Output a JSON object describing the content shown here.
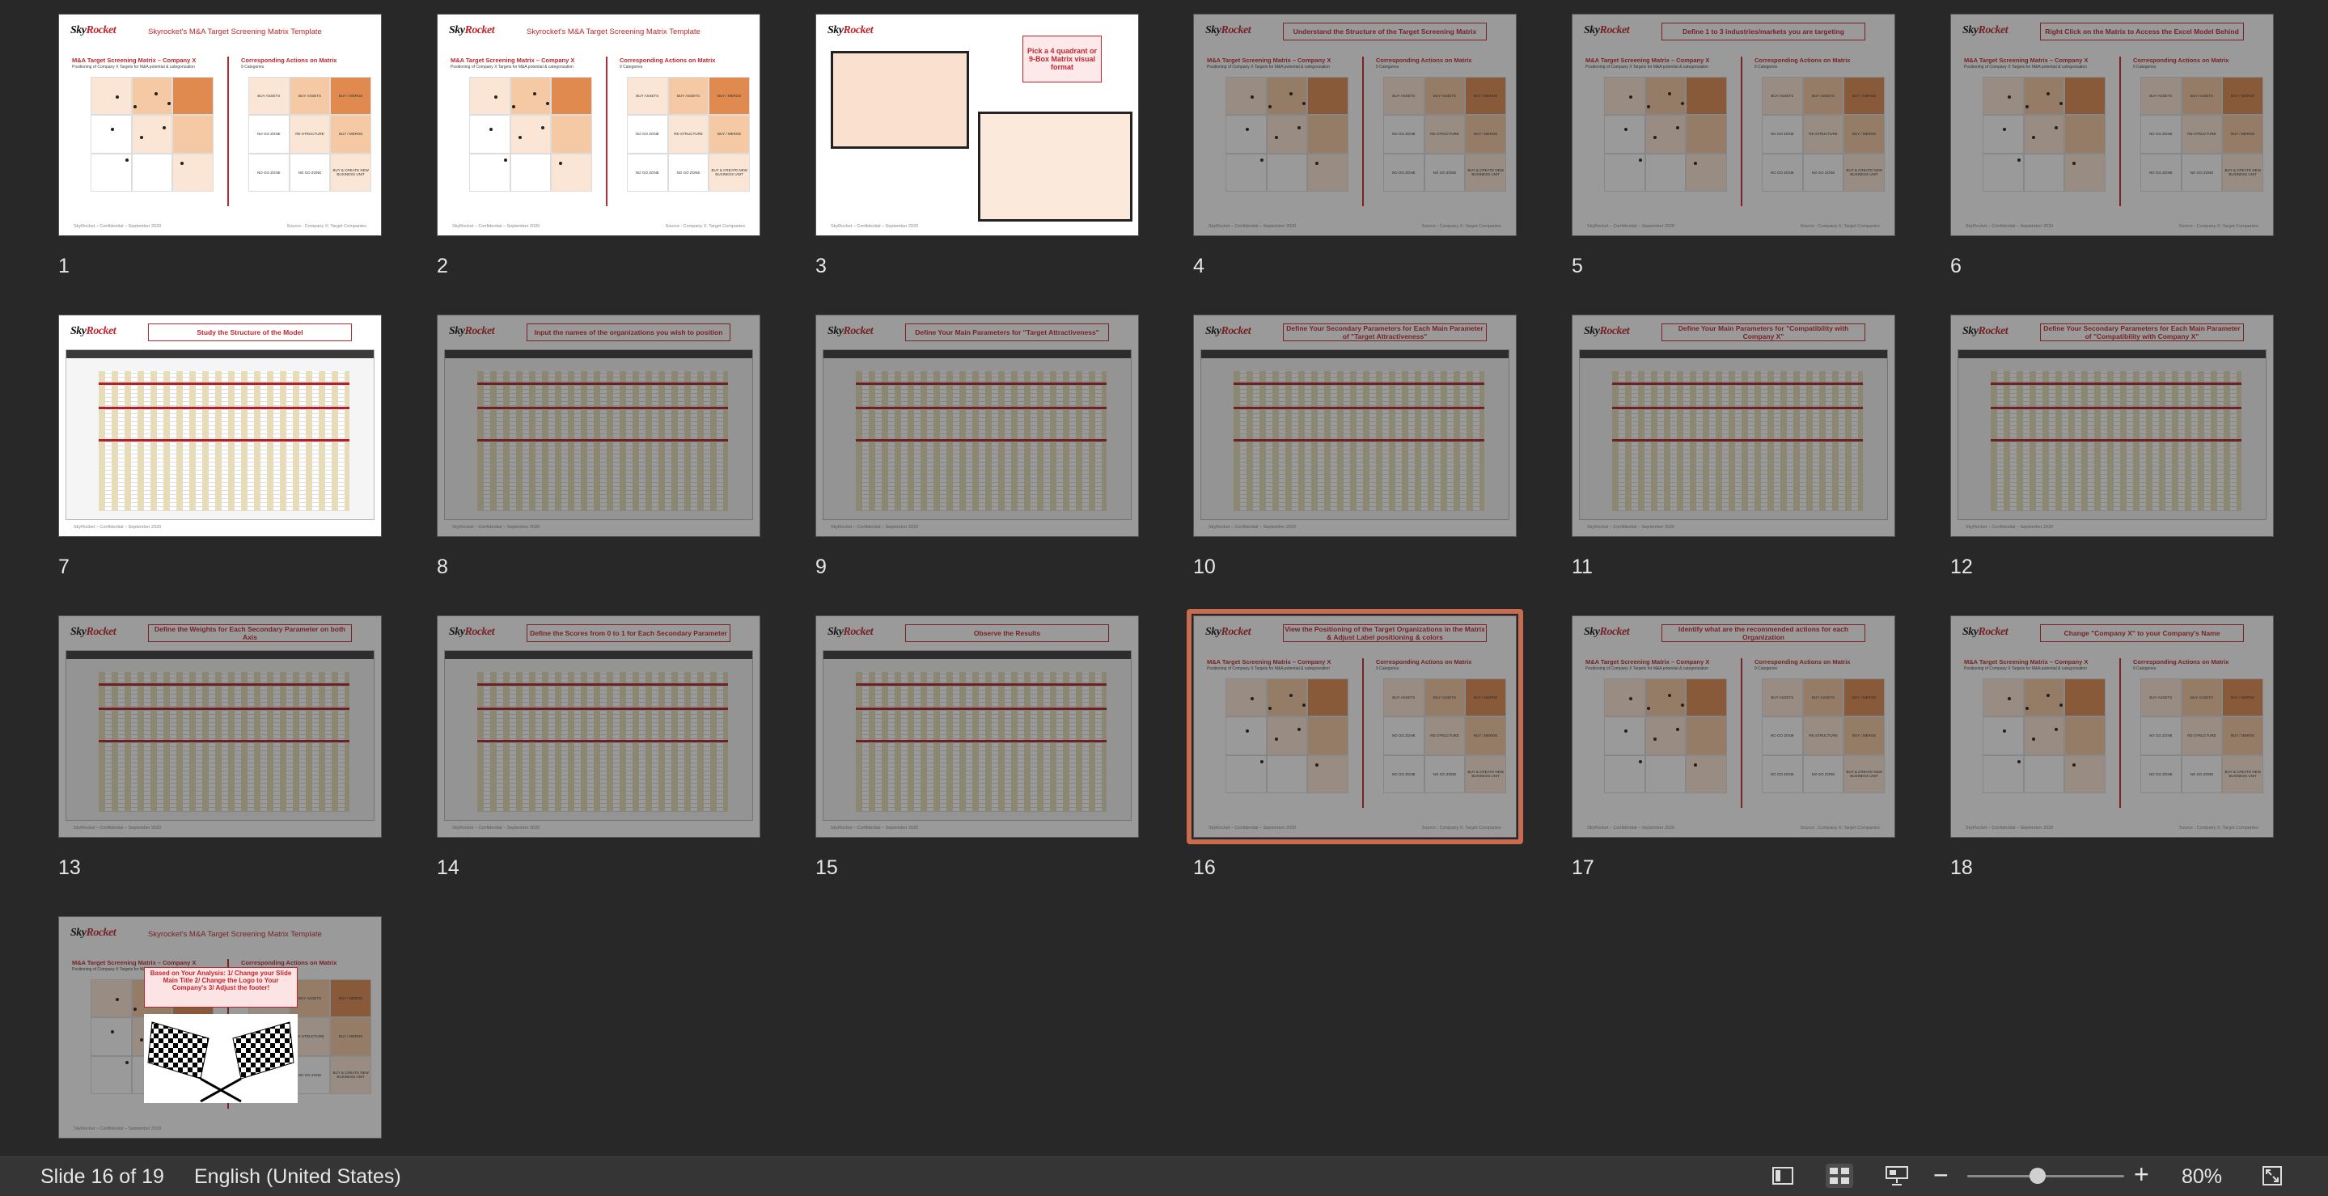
{
  "slides": [
    {
      "num": "1",
      "title": "Skyrocket's M&A Target Screening Matrix Template",
      "kind": "matrix",
      "dim": false,
      "boxed": false
    },
    {
      "num": "2",
      "title": "Skyrocket's M&A Target Screening Matrix Template",
      "kind": "matrix",
      "dim": false,
      "boxed": false
    },
    {
      "num": "3",
      "title": "Pick a 4 quadrant or 9-Box Matrix visual format",
      "kind": "pick",
      "dim": false,
      "boxed": true
    },
    {
      "num": "4",
      "title": "Understand the Structure of the Target Screening Matrix",
      "kind": "matrix",
      "dim": true,
      "boxed": true
    },
    {
      "num": "5",
      "title": "Define 1 to 3 industries/markets you are targeting",
      "kind": "matrix",
      "dim": true,
      "boxed": true
    },
    {
      "num": "6",
      "title": "Right Click on the Matrix to Access the Excel Model Behind",
      "kind": "matrix",
      "dim": true,
      "boxed": true
    },
    {
      "num": "7",
      "title": "Study the Structure of the Model",
      "kind": "sheet",
      "dim": false,
      "boxed": true
    },
    {
      "num": "8",
      "title": "Input the names of the organizations you wish to position",
      "kind": "sheet",
      "dim": true,
      "boxed": true
    },
    {
      "num": "9",
      "title": "Define Your Main Parameters for \"Target Attractiveness\"",
      "kind": "sheet",
      "dim": true,
      "boxed": true
    },
    {
      "num": "10",
      "title": "Define Your Secondary Parameters for Each Main Parameter of \"Target Attractiveness\"",
      "kind": "sheet",
      "dim": true,
      "boxed": true
    },
    {
      "num": "11",
      "title": "Define Your Main Parameters for \"Compatibility with Company X\"",
      "kind": "sheet",
      "dim": true,
      "boxed": true
    },
    {
      "num": "12",
      "title": "Define Your Secondary Parameters for Each Main Parameter of \"Compatibility with Company X\"",
      "kind": "sheet",
      "dim": true,
      "boxed": true
    },
    {
      "num": "13",
      "title": "Define the Weights for Each Secondary Parameter on both Axis",
      "kind": "sheet",
      "dim": true,
      "boxed": true
    },
    {
      "num": "14",
      "title": "Define the Scores from 0 to 1 for Each Secondary Parameter",
      "kind": "sheet",
      "dim": true,
      "boxed": true
    },
    {
      "num": "15",
      "title": "Observe the Results",
      "kind": "sheet",
      "dim": true,
      "boxed": true
    },
    {
      "num": "16",
      "title": "View the Positioning of the Target Organizations in the Matrix & Adjust Label positioning & colors",
      "kind": "matrix",
      "dim": true,
      "boxed": true
    },
    {
      "num": "17",
      "title": "Identify what are the recommended actions for each Organization",
      "kind": "matrix",
      "dim": true,
      "boxed": true
    },
    {
      "num": "18",
      "title": "Change \"Company X\" to your Company's Name",
      "kind": "matrix",
      "dim": true,
      "boxed": true
    },
    {
      "num": "19",
      "title": "Skyrocket's M&A Target Screening Matrix Template",
      "kind": "final",
      "dim": true,
      "boxed": false
    }
  ],
  "selected_slide": "16",
  "logo": {
    "main": "Sky",
    "accent": "Rocket"
  },
  "slide_text": {
    "matrix_title": "M&A Target Screening Matrix – Company X",
    "matrix_sub": "Positioning of Company X Targets for M&A potential & categorization",
    "actions_title": "Corresponding Actions on Matrix",
    "actions_sub": "9 Categories",
    "footer_left": "SkyRocket – Confidential – September 2020",
    "footer_right": "Source : Company X; Target Companies",
    "cells": [
      "BUY ASSETS",
      "BUY ASSETS",
      "BUY / MERGE",
      "NO GO ZONE",
      "RE-STRUCTURE",
      "BUY / MERGE",
      "NO GO ZONE",
      "NO GO ZONE",
      "BUY & CREATE NEW BUSINESS UNIT"
    ],
    "final_note": "Based on Your Analysis: 1/ Change your Slide Main Title 2/ Change the Logo to Your Company's 3/ Adjust the footer!"
  },
  "status": {
    "slide_counter": "Slide 16 of 19",
    "language": "English (United States)",
    "zoom": "80%",
    "zoom_level": 0.45
  },
  "colors": {
    "accent": "#c0262d",
    "selection": "#c86b4e",
    "orange": "#e08a4f",
    "light_orange": "#f4c9a3",
    "pale": "#fbe6d6"
  }
}
